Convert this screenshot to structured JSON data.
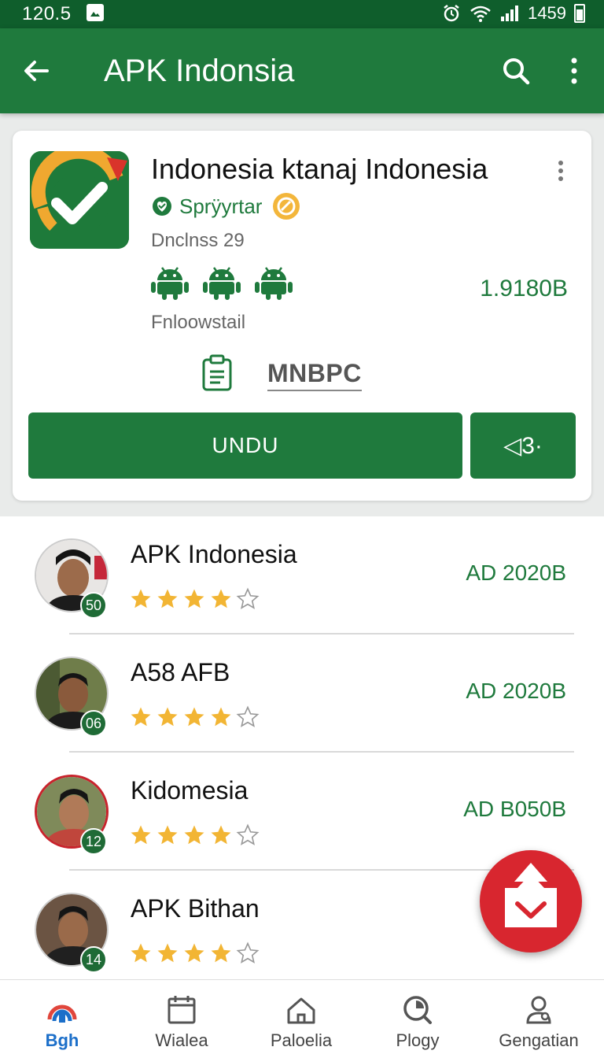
{
  "status_bar": {
    "time": "120.5",
    "battery_text": "1459"
  },
  "app_bar": {
    "title": "APK Indonsia",
    "icons": [
      "back-arrow-icon",
      "search-icon",
      "more-vert-icon"
    ]
  },
  "app_card": {
    "title": "Indonesia ktanaj Indonesia",
    "developer": "Sprÿyrtar",
    "downloads": "Dnclnss 29",
    "size": "1.9180B",
    "follow_label": "Fnloowstail",
    "publisher_label": "MNBPC",
    "download_button": "UNDU",
    "share_button": "◁3·"
  },
  "list": {
    "items": [
      {
        "name": "APK Indonesia",
        "badge": "50",
        "rating": 4,
        "price": "AD 2020B"
      },
      {
        "name": "A58 AFB",
        "badge": "06",
        "rating": 4,
        "price": "AD 2020B"
      },
      {
        "name": "Kidomesia",
        "badge": "12",
        "rating": 4,
        "price": "AD B050B"
      },
      {
        "name": "APK Bithan",
        "badge": "14",
        "rating": 4,
        "price": "AD"
      }
    ]
  },
  "bottom_nav": {
    "items": [
      {
        "label": "Bgh",
        "icon": "home-arc-icon",
        "active": true
      },
      {
        "label": "Wialea",
        "icon": "calendar-icon",
        "active": false
      },
      {
        "label": "Paloelia",
        "icon": "house-icon",
        "active": false
      },
      {
        "label": "Plogy",
        "icon": "search-circle-icon",
        "active": false
      },
      {
        "label": "Gengatian",
        "icon": "user-icon",
        "active": false
      }
    ]
  },
  "colors": {
    "primary": "#1f7a3d",
    "status_bar": "#0f5e2c",
    "fab": "#d8262f",
    "star": "#f2b534",
    "nav_active": "#1c6fc9"
  }
}
